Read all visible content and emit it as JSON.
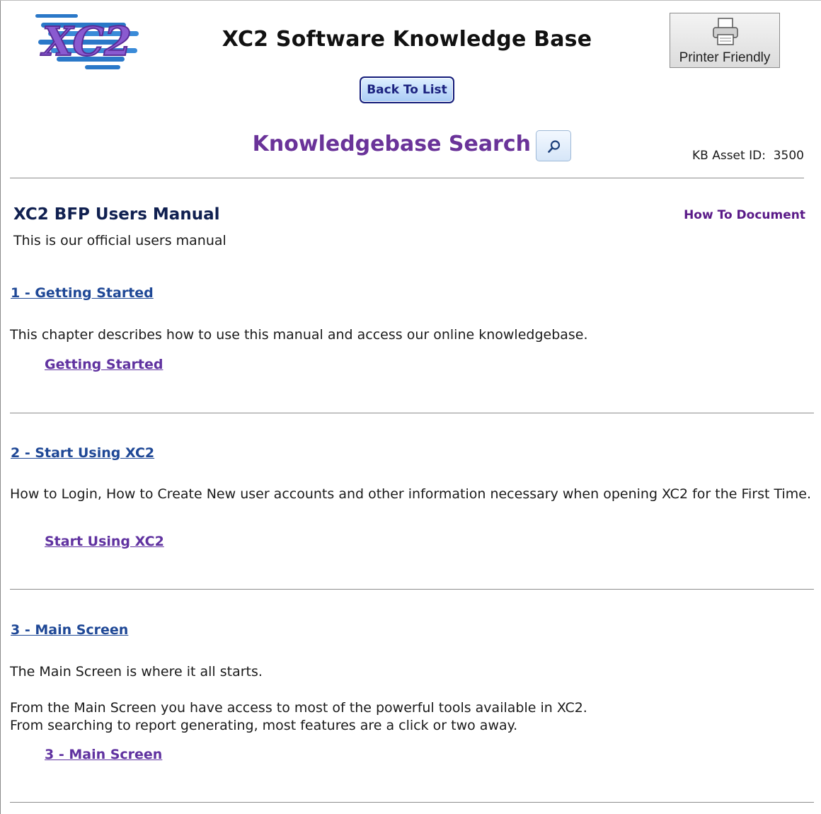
{
  "header": {
    "logo_text": "XC2",
    "site_title": "XC2 Software Knowledge Base",
    "printer_button_label": "Printer Friendly",
    "back_button_label": "Back To List",
    "kb_search_label": "Knowledgebase Search",
    "asset_id_label": "KB Asset ID:  3500"
  },
  "document": {
    "title": "XC2 BFP Users Manual",
    "type": "How To Document",
    "description": "This is our official users manual"
  },
  "chapters": [
    {
      "heading": "1 - Getting Started",
      "paragraphs": [
        "This chapter describes how to use this manual and access our online knowledgebase."
      ],
      "link": "Getting Started"
    },
    {
      "heading": "2 - Start Using XC2",
      "paragraphs": [
        "How to Login, How to Create New user accounts and other information necessary when opening XC2 for the First Time."
      ],
      "link": "Start Using XC2"
    },
    {
      "heading": "3 - Main Screen",
      "paragraphs": [
        "The Main Screen is where it all starts.",
        "From the Main Screen you have access to most of the powerful tools available in XC2.",
        "From searching to report generating, most features are a click or two away."
      ],
      "link": "3 - Main Screen"
    }
  ],
  "colors": {
    "heading_link": "#1f4896",
    "sub_link": "#6032a0",
    "search_title": "#6a3399",
    "doc_type": "#5a1a88"
  }
}
